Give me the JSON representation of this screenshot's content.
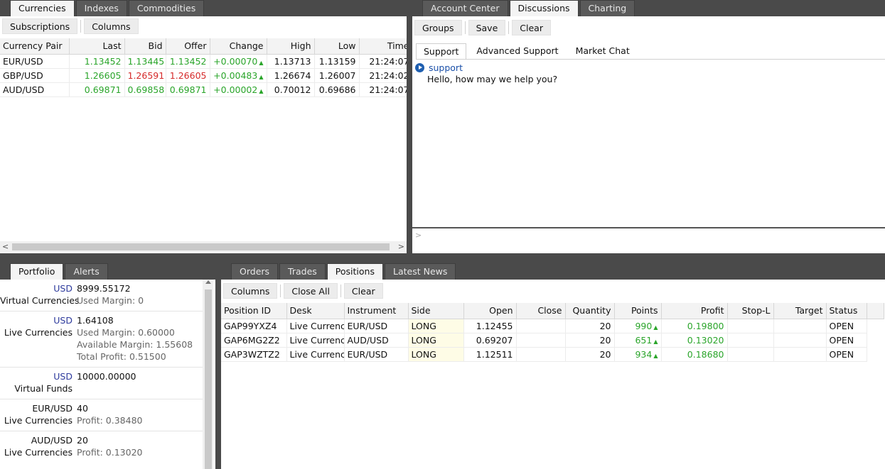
{
  "currencies": {
    "tabs": [
      {
        "label": "Currencies",
        "active": true
      },
      {
        "label": "Indexes",
        "active": false
      },
      {
        "label": "Commodities",
        "active": false
      }
    ],
    "toolbar": {
      "subscriptions": "Subscriptions",
      "columns": "Columns"
    },
    "headers": [
      "Currency Pair",
      "Last",
      "Bid",
      "Offer",
      "Change",
      "High",
      "Low",
      "Time"
    ],
    "rows": [
      {
        "pair": "EUR/USD",
        "last": "1.13452",
        "bid": "1.13445",
        "offer": "1.13452",
        "change": "+0.00070",
        "high": "1.13713",
        "low": "1.13159",
        "time": "21:24:07"
      },
      {
        "pair": "GBP/USD",
        "last": "1.26605",
        "bid": "1.26591",
        "offer": "1.26605",
        "change": "+0.00483",
        "high": "1.26674",
        "low": "1.26007",
        "time": "21:24:02"
      },
      {
        "pair": "AUD/USD",
        "last": "0.69871",
        "bid": "0.69858",
        "offer": "0.69871",
        "change": "+0.00002",
        "high": "0.70012",
        "low": "0.69686",
        "time": "21:24:07"
      }
    ],
    "bid_colors": [
      "green",
      "red",
      "green"
    ],
    "offer_colors": [
      "green",
      "red",
      "green"
    ]
  },
  "discussions": {
    "tabs": [
      {
        "label": "Account Center",
        "active": false
      },
      {
        "label": "Discussions",
        "active": true
      },
      {
        "label": "Charting",
        "active": false
      }
    ],
    "toolbar": {
      "groups": "Groups",
      "save": "Save",
      "clear": "Clear"
    },
    "subtabs": [
      {
        "label": "Support",
        "active": true
      },
      {
        "label": "Advanced Support",
        "active": false
      },
      {
        "label": "Market Chat",
        "active": false
      }
    ],
    "message": {
      "sender": "support",
      "text": "Hello, how may we help you?"
    },
    "input_prompt": ">"
  },
  "portfolio": {
    "tabs": [
      {
        "label": "Portfolio",
        "active": true
      },
      {
        "label": "Alerts",
        "active": false
      }
    ],
    "groups": [
      {
        "ccy": "USD",
        "value": "8999.55172",
        "label": "Virtual Currencies",
        "details": [
          "Used Margin:  0"
        ]
      },
      {
        "ccy": "USD",
        "value": "1.64108",
        "label": "Live Currencies",
        "details": [
          "Used Margin:  0.60000",
          "Available Margin:  1.55608",
          "Total Profit:  0.51500"
        ]
      },
      {
        "ccy": "USD",
        "value": "10000.00000",
        "label": "Virtual Funds",
        "details": []
      },
      {
        "ccy": "EUR/USD",
        "value": "40",
        "label": "Live Currencies",
        "details": [
          "Profit:  0.38480"
        ]
      },
      {
        "ccy": "AUD/USD",
        "value": "20",
        "label": "Live Currencies",
        "details": [
          "Profit:  0.13020"
        ]
      }
    ]
  },
  "positions": {
    "tabs": [
      {
        "label": "Orders",
        "active": false
      },
      {
        "label": "Trades",
        "active": false
      },
      {
        "label": "Positions",
        "active": true
      },
      {
        "label": "Latest News",
        "active": false
      }
    ],
    "toolbar": {
      "columns": "Columns",
      "close_all": "Close All",
      "clear": "Clear"
    },
    "headers": [
      "Position ID",
      "Desk",
      "Instrument",
      "Side",
      "Open",
      "Close",
      "Quantity",
      "Points",
      "Profit",
      "Stop-L",
      "Target",
      "Status"
    ],
    "rows": [
      {
        "id": "GAP99YXZ4",
        "desk": "Live Currencies",
        "instrument": "EUR/USD",
        "side": "LONG",
        "open": "1.12455",
        "close": "",
        "quantity": "20",
        "points": "990",
        "profit": "0.19800",
        "stop": "",
        "target": "",
        "status": "OPEN"
      },
      {
        "id": "GAP6MG2Z2",
        "desk": "Live Currencies",
        "instrument": "AUD/USD",
        "side": "LONG",
        "open": "0.69207",
        "close": "",
        "quantity": "20",
        "points": "651",
        "profit": "0.13020",
        "stop": "",
        "target": "",
        "status": "OPEN"
      },
      {
        "id": "GAP3WZTZ2",
        "desk": "Live Currencies",
        "instrument": "EUR/USD",
        "side": "LONG",
        "open": "1.12511",
        "close": "",
        "quantity": "20",
        "points": "934",
        "profit": "0.18680",
        "stop": "",
        "target": "",
        "status": "OPEN"
      }
    ]
  },
  "arrow_glyph": "▲",
  "colors": {
    "green": "#2aa52a",
    "red": "#d52a2a",
    "ccy_blue": "#2d3a9c",
    "side_bg": "#fefce6"
  }
}
